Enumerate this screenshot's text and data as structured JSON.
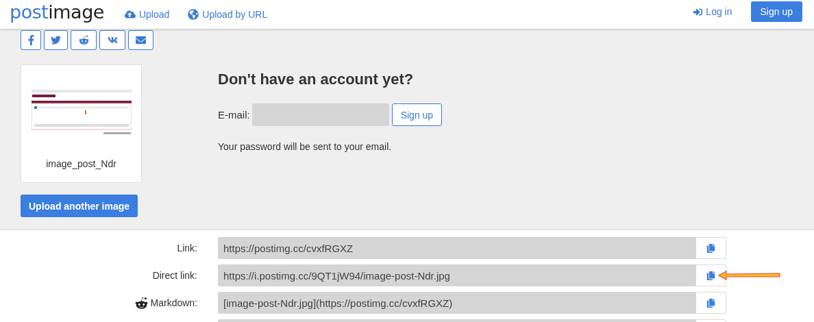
{
  "header": {
    "logo": {
      "part_1": "post",
      "part_2": "image"
    },
    "nav": [
      {
        "label": "Upload",
        "kind": "upload"
      },
      {
        "label": "Upload by URL",
        "kind": "url"
      }
    ],
    "login": "Log in",
    "signup": "Sign up"
  },
  "share": [
    {
      "kind": "facebook"
    },
    {
      "kind": "twitter"
    },
    {
      "kind": "reddit"
    },
    {
      "kind": "vk"
    },
    {
      "kind": "email"
    }
  ],
  "upload": {
    "thumbnail": {
      "kind": "picture",
      "caption": "image_post_Ndr"
    },
    "button": "Upload another image"
  },
  "account": {
    "heading": "Don't have an account yet?",
    "email_label": "E-mail:",
    "button": "Sign up",
    "note": "Your password will be sent to your email."
  },
  "links": [
    {
      "label": "Link:",
      "value": "https://postimg.cc/cvxfRGXZ"
    },
    {
      "label": "Direct link:",
      "value": "https://i.postimg.cc/9QT1jW94/image-post-Ndr.jpg",
      "kind": "arrow"
    },
    {
      "label": "Markdown:",
      "value": "[image-post-Ndr.jpg](https://postimg.cc/cvxfRGXZ)",
      "kind": "reddit"
    },
    {
      "kind": "partial"
    }
  ]
}
